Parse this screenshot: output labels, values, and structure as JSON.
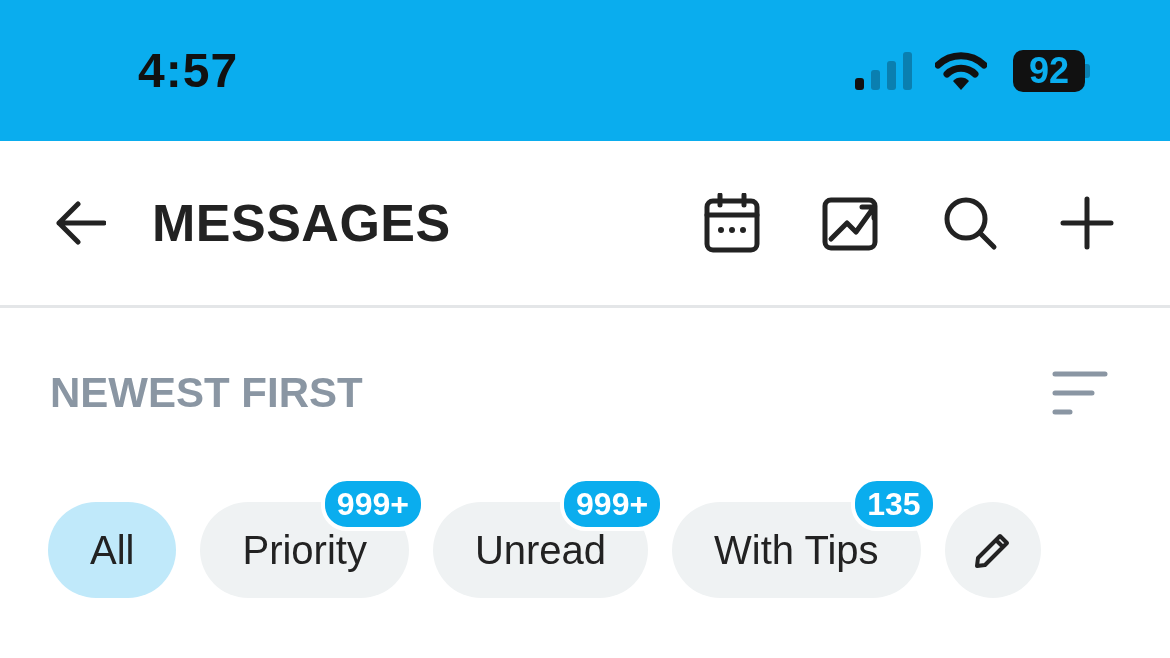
{
  "status_bar": {
    "time": "4:57",
    "battery": "92"
  },
  "header": {
    "title": "MESSAGES"
  },
  "sort": {
    "label": "NEWEST FIRST"
  },
  "filters": [
    {
      "kind": "filter",
      "label": "All",
      "selected": true
    },
    {
      "kind": "filter",
      "label": "Priority",
      "selected": false,
      "badge": "999+"
    },
    {
      "kind": "filter",
      "label": "Unread",
      "selected": false,
      "badge": "999+"
    },
    {
      "kind": "filter",
      "label": "With Tips",
      "selected": false,
      "badge": "135"
    },
    {
      "kind": "edit"
    }
  ]
}
